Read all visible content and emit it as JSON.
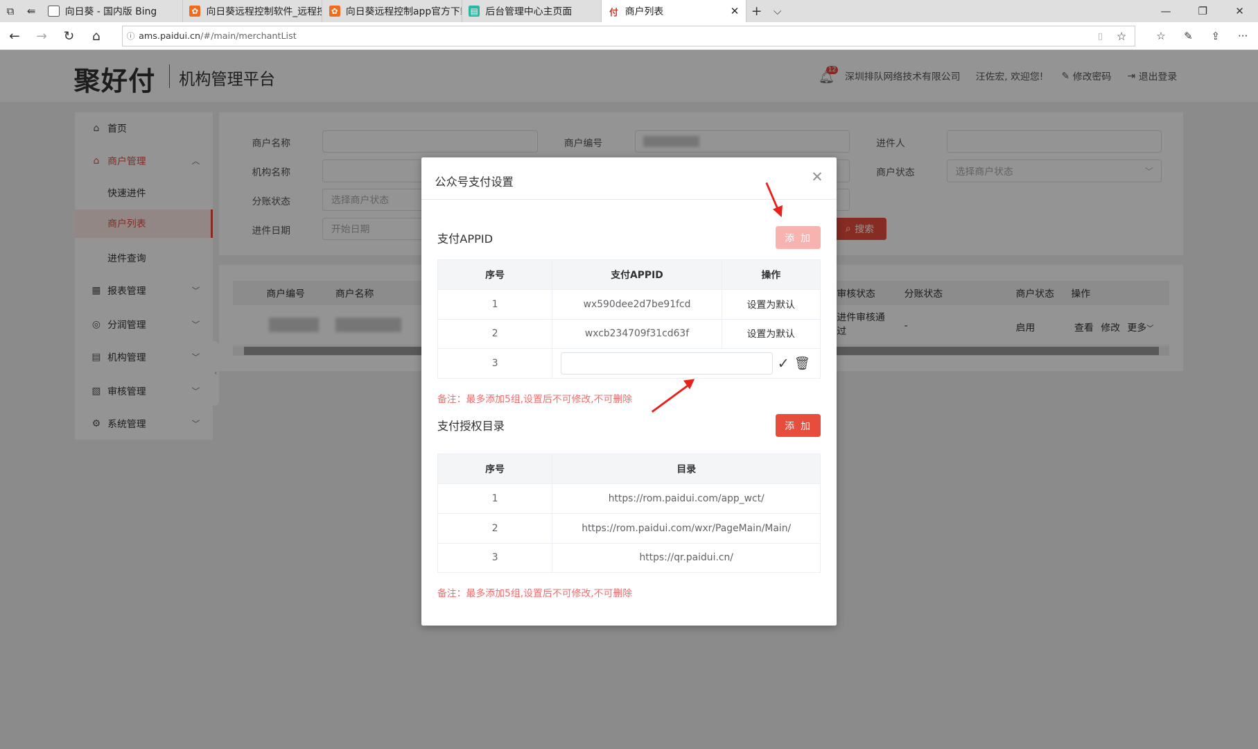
{
  "browser": {
    "tabs": [
      {
        "title": "向日葵 - 国内版 Bing",
        "icon": "browser-page-icon",
        "color": "#555555"
      },
      {
        "title": "向日葵远程控制软件_远程控",
        "icon": "sunflower-icon",
        "color": "#f26b1d"
      },
      {
        "title": "向日葵远程控制app官方下载",
        "icon": "sunflower-icon",
        "color": "#f26b1d"
      },
      {
        "title": "后台管理中心主页面",
        "icon": "admin-icon",
        "color": "#2bb5a3"
      },
      {
        "title": "商户列表",
        "icon": "pay-icon",
        "color": "#c0392b"
      }
    ],
    "url_host": "ams.paidui.cn",
    "url_path": "/#/main/merchantList"
  },
  "header": {
    "logo": "聚好付",
    "platform": "机构管理平台",
    "notification_count": "12",
    "company": "深圳排队网络技术有限公司",
    "welcome": "汪佐宏, 欢迎您!",
    "change_password": "修改密码",
    "logout": "退出登录"
  },
  "sidebar": {
    "items": [
      {
        "label": "首页",
        "icon": "home-icon"
      },
      {
        "label": "商户管理",
        "icon": "shop-icon"
      },
      {
        "label": "快速进件"
      },
      {
        "label": "商户列表"
      },
      {
        "label": "进件查询"
      },
      {
        "label": "报表管理",
        "icon": "report-icon"
      },
      {
        "label": "分润管理",
        "icon": "profit-icon"
      },
      {
        "label": "机构管理",
        "icon": "org-icon"
      },
      {
        "label": "审核管理",
        "icon": "audit-icon"
      },
      {
        "label": "系统管理",
        "icon": "settings-icon"
      }
    ]
  },
  "filter": {
    "merchant_name": "商户名称",
    "merchant_no": "商户编号",
    "applicant": "进件人",
    "org_name": "机构名称",
    "merchant_status": "商户状态",
    "merchant_status_placeholder": "选择商户状态",
    "split_status": "分账状态",
    "split_status_placeholder": "选择商户状态",
    "date": "进件日期",
    "date_placeholder": "开始日期",
    "search": "搜索"
  },
  "list": {
    "headers": [
      "商户编号",
      "商户名称",
      "审核状态",
      "分账状态",
      "商户状态",
      "操作"
    ],
    "row": {
      "audit": "进件审核通过",
      "split": "-",
      "status": "启用",
      "view": "查看",
      "edit": "修改",
      "more": "更多"
    }
  },
  "modal": {
    "title": "公众号支付设置",
    "appid_section": "支付APPID",
    "add_label": "添 加",
    "appid_headers": [
      "序号",
      "支付APPID",
      "操作"
    ],
    "appid_rows": [
      {
        "no": "1",
        "appid": "wx590dee2d7be91fcd",
        "action": "设置为默认"
      },
      {
        "no": "2",
        "appid": "wxcb234709f31cd63f",
        "action": "设置为默认"
      }
    ],
    "new_row_no": "3",
    "new_row_value": "",
    "note": "备注：最多添加5组,设置后不可修改,不可删除",
    "dir_section": "支付授权目录",
    "dir_headers": [
      "序号",
      "目录"
    ],
    "dir_rows": [
      {
        "no": "1",
        "dir": "https://rom.paidui.com/app_wct/"
      },
      {
        "no": "2",
        "dir": "https://rom.paidui.com/wxr/PageMain/Main/"
      },
      {
        "no": "3",
        "dir": "https://qr.paidui.cn/"
      }
    ]
  },
  "colors": {
    "accent": "#e74c3c",
    "accent_disabled": "#f7b3b0",
    "sidebar_active_bg": "#fde8e7"
  }
}
